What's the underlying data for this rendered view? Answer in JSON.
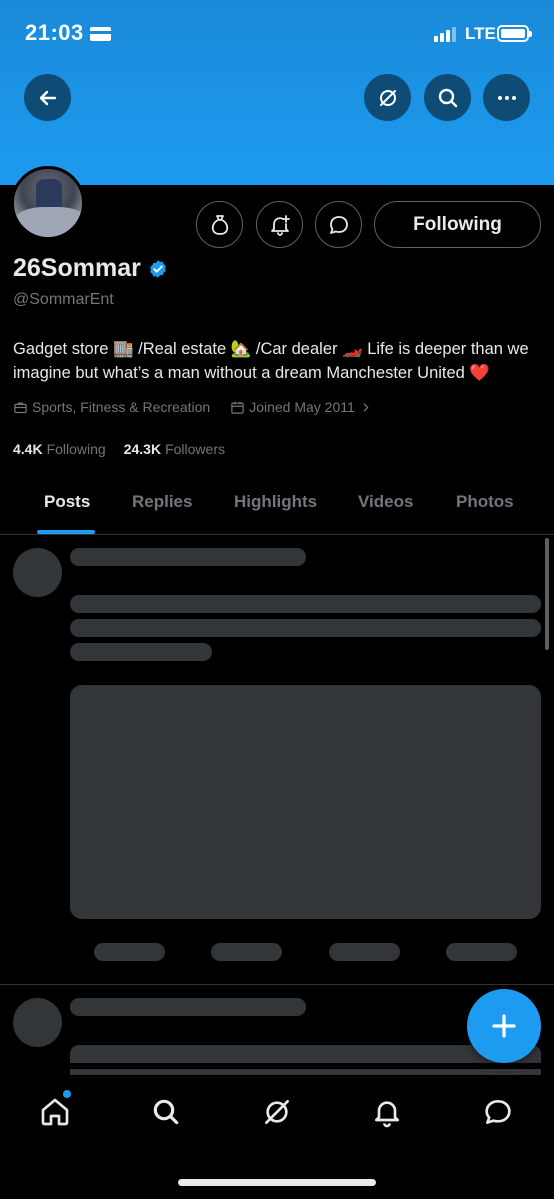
{
  "status_bar": {
    "time": "21:03",
    "network": "LTE"
  },
  "profile": {
    "display_name": "26Sommar",
    "handle": "@SommarEnt",
    "bio": "Gadget store 🏬 /Real estate 🏡 /Car dealer 🏎️ Life is deeper than we imagine but what’s a man without a dream Manchester United ❤️",
    "category": "Sports, Fitness & Recreation",
    "joined": "Joined May 2011",
    "following_count": "4.4K",
    "following_label": "Following",
    "followers_count": "24.3K",
    "followers_label": "Followers",
    "follow_button_label": "Following"
  },
  "tabs": [
    "Posts",
    "Replies",
    "Highlights",
    "Videos",
    "Photos"
  ],
  "active_tab": "Posts",
  "icons": {
    "header": [
      "back-arrow-icon",
      "grok-icon",
      "search-icon",
      "more-icon"
    ],
    "actions": [
      "money-bag-icon",
      "notification-bell-icon",
      "message-icon"
    ],
    "bottom_nav": [
      "home-icon",
      "search-icon",
      "grok-icon",
      "notifications-icon",
      "messages-icon"
    ],
    "fab": "compose-plus-icon"
  },
  "colors": {
    "accent": "#1d9bf0",
    "banner": "#1d9bf0",
    "background": "#000000",
    "secondary_text": "#71767b",
    "skeleton": "#333639"
  }
}
